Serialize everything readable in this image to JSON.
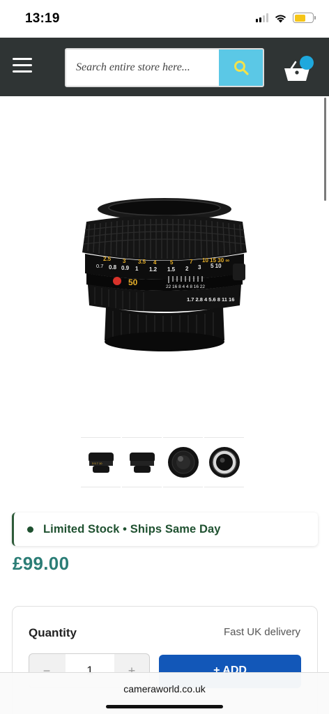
{
  "status_bar": {
    "time": "13:19",
    "icons": [
      "signal-icon",
      "wifi-icon",
      "battery-icon"
    ],
    "battery_color": "#f5c518"
  },
  "header": {
    "background": "#2f3434",
    "search": {
      "placeholder": "Search entire store here...",
      "value": "",
      "button_color": "#5bc8e6"
    },
    "menu_icon": "hamburger-icon",
    "cart_icon": "basket-icon"
  },
  "product": {
    "image_icon": "camera-lens-image",
    "lens_markings": {
      "aperture_top": "50",
      "distance_feet": [
        "2.5",
        "3",
        "3.5",
        "4",
        "5",
        "7",
        "10",
        "15",
        "30",
        "∞"
      ],
      "distance_meters": [
        "0.7",
        "0.8",
        "0.9",
        "1",
        "1.2",
        "1.5",
        "2",
        "3",
        "5",
        "10"
      ],
      "dof_scale": "22 16  8 4 4 8  16 22",
      "aperture_ring": [
        "1.7",
        "2.8",
        "4",
        "5.6",
        "8",
        "11",
        "16"
      ]
    },
    "thumbnails": [
      {
        "name": "thumbnail-lens-side"
      },
      {
        "name": "thumbnail-lens-back"
      },
      {
        "name": "thumbnail-lens-front"
      },
      {
        "name": "thumbnail-lens-rear-mount"
      }
    ],
    "stock_banner": "Limited Stock • Ships Same Day",
    "stock_color": "#1f5130",
    "price": "£99.00",
    "price_color": "#2b7d76"
  },
  "purchase": {
    "quantity_label": "Quantity",
    "delivery_text": "Fast UK delivery",
    "quantity_value": "1",
    "minus": "−",
    "plus": "+",
    "add_label": "+ ADD",
    "add_color": "#1257b8"
  },
  "browser": {
    "url": "cameraworld.co.uk"
  }
}
